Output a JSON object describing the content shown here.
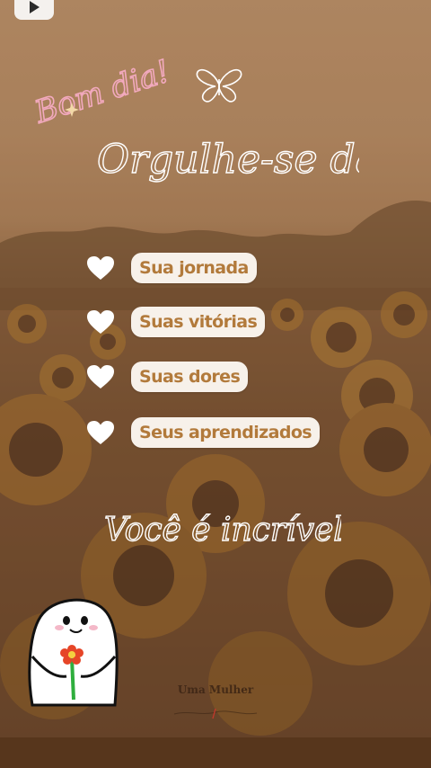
{
  "video": {
    "play_icon": "play-icon"
  },
  "greeting": {
    "text": "Bom dia!"
  },
  "decorations": {
    "butterfly_icon": "butterfly-icon",
    "sparkle_icon": "sparkle-icon",
    "heart_icon": "heart-icon"
  },
  "title": {
    "text": "Orgulhe-se da"
  },
  "items": [
    {
      "label": "Sua jornada"
    },
    {
      "label": "Suas vitórias"
    },
    {
      "label": "Suas dores"
    },
    {
      "label": "Seus aprendizados"
    }
  ],
  "subtitle": {
    "text": "Você é incrível"
  },
  "sticker": {
    "name": "character-holding-flower"
  },
  "brand": {
    "text": "Uma Mulher"
  },
  "colors": {
    "pill_bg": "#f7f1ea",
    "pill_text": "#b27a3b",
    "greeting_pink": "#f2a9be",
    "script_white": "#ffffff"
  }
}
